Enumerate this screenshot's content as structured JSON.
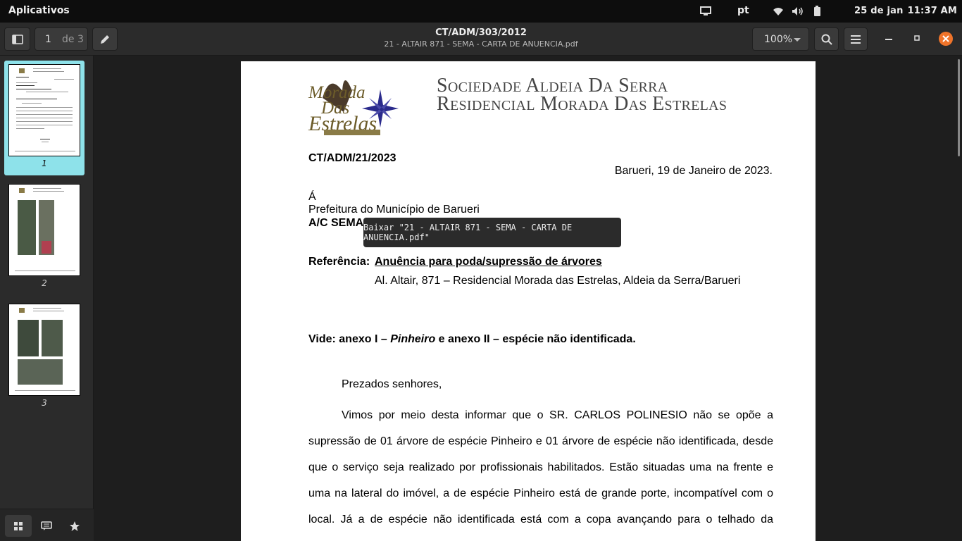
{
  "system_bar": {
    "apps_label": "Aplicativos",
    "language": "pt",
    "date": "25 de jan",
    "time": "11:37 AM",
    "icons": [
      "screen-icon",
      "wifi-icon",
      "volume-icon",
      "battery-icon"
    ]
  },
  "header": {
    "page_current": "1",
    "page_total_label": "de 3",
    "title": "CT/ADM/303/2012",
    "filename": "21 - ALTAIR 871 - SEMA - CARTA DE ANUENCIA.pdf",
    "zoom": "100%"
  },
  "sidebar": {
    "thumbnails": [
      {
        "label": "1",
        "selected": true
      },
      {
        "label": "2",
        "selected": false
      },
      {
        "label": "3",
        "selected": false
      }
    ]
  },
  "tooltip": "Baixar \"21 - ALTAIR 871 - SEMA - CARTA DE ANUENCIA.pdf\"",
  "document": {
    "logo_line1": "Sociedade Aldeia Da Serra",
    "logo_line2": "Residencial Morada Das Estrelas",
    "logo_script1": "Morada",
    "logo_script2": "Das",
    "logo_script3": "Estrelas",
    "ref_code": "CT/ADM/21/2023",
    "date_line": "Barueri, 19 de Janeiro de 2023.",
    "to": "Á",
    "recipient": "Prefeitura do Município de Barueri",
    "attention": "A/C SEMA – Secretaria de Meio Ambiente",
    "reference_label": "Referência:",
    "reference_subject": "Anuência para poda/supressão de árvores",
    "address": "Al. Altair, 871 – Residencial Morada das Estrelas, Aldeia da Serra/Barueri",
    "vide_prefix": "Vide: anexo I – ",
    "vide_italic": "Pinheiro",
    "vide_suffix": " e anexo II – espécie não identificada.",
    "salutation": "Prezados senhores,",
    "body_lines": [
      "Vimos por meio desta informar que o SR. CARLOS POLINESIO não se opõe a",
      "supressão de 01 árvore de espécie Pinheiro e 01 árvore de espécie não identificada, desde",
      "que o serviço seja realizado por profissionais habilitados. Estão situadas uma na frente e",
      "uma na lateral do imóvel, a de espécie Pinheiro está de grande porte, incompatível com o",
      "local. Já a de espécie não identificada está com a copa avançando para o telhado da"
    ]
  }
}
